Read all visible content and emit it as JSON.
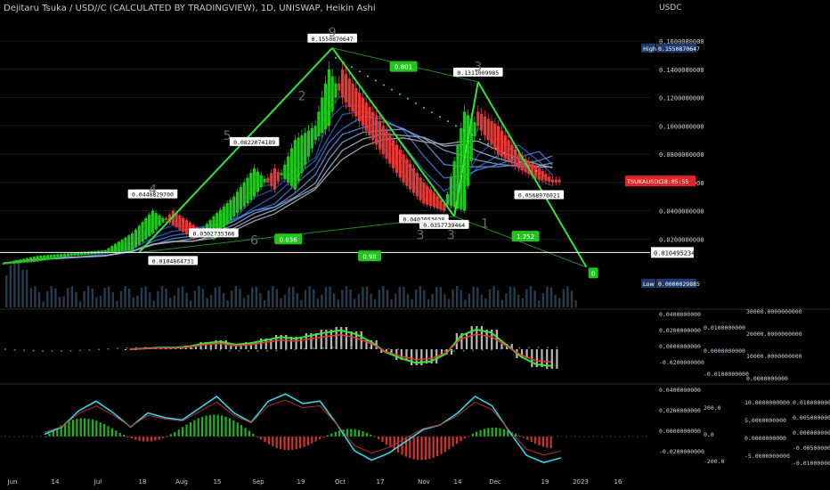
{
  "header": {
    "title": "Dejitaru Tsuka / USD//C (CALCULATED BY TRADINGVIEW), 1D, UNISWAP, Heikin Ashi",
    "currency": "USDC"
  },
  "chart_data": {
    "type": "candlestick",
    "price_axis": {
      "ticks": [
        "0.1600000000",
        "0.1400000000",
        "0.1200000000",
        "0.1000000000",
        "0.0800000000",
        "0.0600000000",
        "0.0400000000",
        "0.0200000000"
      ],
      "tick_values": [
        0.16,
        0.14,
        0.12,
        0.1,
        0.08,
        0.06,
        0.04,
        0.02
      ]
    },
    "date_axis": [
      "Jun",
      "14",
      "Jul",
      "18",
      "Aug",
      "15",
      "Sep",
      "19",
      "Oct",
      "17",
      "Nov",
      "14",
      "Dec",
      "19",
      "2023",
      "16"
    ],
    "markers": {
      "high": {
        "label": "High",
        "value": "0.1550870647"
      },
      "low": {
        "label": "Low",
        "value": "0.0000029885"
      },
      "symbol": {
        "name": "TSUKAUSDC",
        "countdown": "18:05:55"
      },
      "horizontal_level": "0.0104952349"
    },
    "annotations": [
      {
        "text": "0.1550870647",
        "kind": "peak"
      },
      {
        "text": "0.1311009985",
        "kind": "peak"
      },
      {
        "text": "0.0822074189",
        "kind": "peak"
      },
      {
        "text": "0.0448829700",
        "kind": "peak"
      },
      {
        "text": "0.0302735366",
        "kind": "trough"
      },
      {
        "text": "0.0104864731",
        "kind": "trough"
      },
      {
        "text": "0.0402053638",
        "kind": "trough"
      },
      {
        "text": "0.0357739464",
        "kind": "trough"
      },
      {
        "text": "0.0568976021",
        "kind": "trough"
      }
    ],
    "wave_labels": [
      "9",
      "2",
      "5",
      "4",
      "6",
      "3",
      "3",
      "3",
      "1"
    ],
    "ratio_labels": [
      "0.801",
      "0.836",
      "0.98",
      "1.252",
      "0"
    ],
    "price_series": [
      {
        "d": 0,
        "o": 0.002,
        "h": 0.004,
        "l": 0.001,
        "c": 0.003
      },
      {
        "d": 10,
        "o": 0.004,
        "h": 0.009,
        "l": 0.003,
        "c": 0.008
      },
      {
        "d": 20,
        "o": 0.008,
        "h": 0.012,
        "l": 0.005,
        "c": 0.01
      },
      {
        "d": 30,
        "o": 0.01,
        "h": 0.014,
        "l": 0.008,
        "c": 0.012
      },
      {
        "d": 38,
        "o": 0.012,
        "h": 0.025,
        "l": 0.01,
        "c": 0.024
      },
      {
        "d": 44,
        "o": 0.024,
        "h": 0.045,
        "l": 0.022,
        "c": 0.04
      },
      {
        "d": 50,
        "o": 0.04,
        "h": 0.042,
        "l": 0.025,
        "c": 0.03
      },
      {
        "d": 56,
        "o": 0.03,
        "h": 0.038,
        "l": 0.011,
        "c": 0.02
      },
      {
        "d": 62,
        "o": 0.02,
        "h": 0.04,
        "l": 0.018,
        "c": 0.036
      },
      {
        "d": 68,
        "o": 0.036,
        "h": 0.055,
        "l": 0.03,
        "c": 0.05
      },
      {
        "d": 74,
        "o": 0.05,
        "h": 0.082,
        "l": 0.045,
        "c": 0.07
      },
      {
        "d": 80,
        "o": 0.07,
        "h": 0.075,
        "l": 0.045,
        "c": 0.055
      },
      {
        "d": 86,
        "o": 0.055,
        "h": 0.095,
        "l": 0.05,
        "c": 0.09
      },
      {
        "d": 92,
        "o": 0.09,
        "h": 0.11,
        "l": 0.078,
        "c": 0.1
      },
      {
        "d": 96,
        "o": 0.1,
        "h": 0.155,
        "l": 0.095,
        "c": 0.14
      },
      {
        "d": 100,
        "o": 0.14,
        "h": 0.145,
        "l": 0.11,
        "c": 0.12
      },
      {
        "d": 106,
        "o": 0.12,
        "h": 0.125,
        "l": 0.095,
        "c": 0.1
      },
      {
        "d": 112,
        "o": 0.1,
        "h": 0.105,
        "l": 0.075,
        "c": 0.08
      },
      {
        "d": 118,
        "o": 0.08,
        "h": 0.085,
        "l": 0.055,
        "c": 0.06
      },
      {
        "d": 124,
        "o": 0.06,
        "h": 0.065,
        "l": 0.04,
        "c": 0.045
      },
      {
        "d": 130,
        "o": 0.045,
        "h": 0.05,
        "l": 0.036,
        "c": 0.04
      },
      {
        "d": 136,
        "o": 0.04,
        "h": 0.12,
        "l": 0.038,
        "c": 0.11
      },
      {
        "d": 140,
        "o": 0.11,
        "h": 0.131,
        "l": 0.095,
        "c": 0.1
      },
      {
        "d": 146,
        "o": 0.1,
        "h": 0.105,
        "l": 0.075,
        "c": 0.08
      },
      {
        "d": 152,
        "o": 0.08,
        "h": 0.085,
        "l": 0.062,
        "c": 0.07
      },
      {
        "d": 158,
        "o": 0.07,
        "h": 0.075,
        "l": 0.057,
        "c": 0.062
      },
      {
        "d": 162,
        "o": 0.062,
        "h": 0.07,
        "l": 0.04,
        "c": 0.06
      }
    ],
    "indicator1": {
      "left_ticks": [
        "0.0400000000",
        "0.0200000000",
        "0.0000000000",
        "-0.0200000000"
      ],
      "mid_ticks": [
        "0.0100000000",
        "0.0000000000",
        "-0.0100000000"
      ],
      "right_ticks": [
        "30000.0000000000",
        "20000.0000000000",
        "10000.0000000000",
        "0.0000000000"
      ],
      "histogram": [
        0,
        0.001,
        0.002,
        0.002,
        0.004,
        0.008,
        0.01,
        0.006,
        0.008,
        0.012,
        0.016,
        0.014,
        0.018,
        0.022,
        0.025,
        0.02,
        0.01,
        -0.004,
        -0.012,
        -0.018,
        -0.016,
        -0.006,
        0.018,
        0.026,
        0.022,
        0.006,
        -0.01,
        -0.02,
        -0.022
      ]
    },
    "indicator2": {
      "left_ticks": [
        "0.0400000000",
        "0.0200000000",
        "0.0000000000",
        "-0.0200000000"
      ],
      "mid_ticks": [
        "200.0",
        "0.0",
        "-200.0"
      ],
      "right_ticks": [
        "10.0000000000",
        "5.0000000000",
        "0.0000000000",
        "-5.0000000000"
      ],
      "far_right_ticks": [
        "0.0100000000",
        "0.0050000000",
        "0.0000000000",
        "-0.0050000000",
        "-0.0100000000"
      ],
      "oscillator": [
        0.002,
        0.008,
        0.022,
        0.03,
        0.02,
        0.008,
        0.02,
        0.016,
        0.014,
        0.024,
        0.034,
        0.02,
        0.012,
        0.03,
        0.036,
        0.028,
        0.03,
        0.01,
        -0.012,
        -0.02,
        -0.014,
        -0.004,
        0.006,
        0.01,
        0.02,
        0.034,
        0.026,
        0.004,
        -0.016,
        -0.022,
        -0.018
      ]
    }
  },
  "colors": {
    "bull": "#22c51e",
    "bear": "#e53935",
    "accent": "#35e335",
    "cyan": "#33d4e8",
    "high_bg": "#1e3a6a",
    "symbol_bg": "#e3242b"
  }
}
